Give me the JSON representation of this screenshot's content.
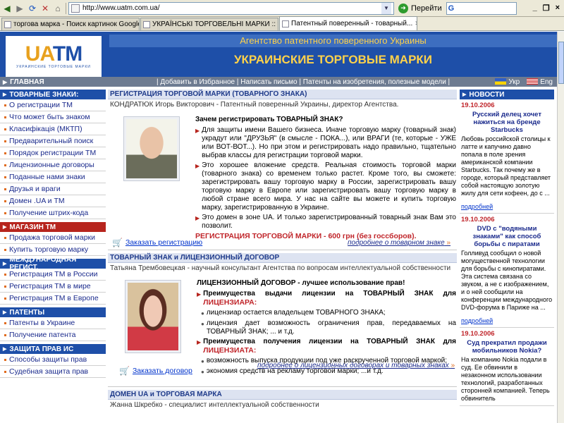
{
  "browser": {
    "url": "http://www.uatm.com.ua/",
    "go_label": "Перейти",
    "search_brand": "G",
    "window_controls": [
      "_",
      "❐",
      "×"
    ],
    "tabs": [
      {
        "label": "торгова марка - Поиск картинок Google",
        "active": false
      },
      {
        "label": "УКРАЇНСЬКІ ТОРГОВЕЛЬНІ МАРКИ :: торг...",
        "active": false
      },
      {
        "label": "Патентный поверенный - товарный...",
        "active": true
      }
    ]
  },
  "banner": {
    "logo_text_a": "UA",
    "logo_text_b": "TM",
    "logo_sub": "УКРАИНСКИЕ ТОРГОВЫЕ МАРКИ",
    "agency": "Агентство патентного поверенного Украины",
    "title": "УКРАИНСКИЕ ТОРГОВЫЕ МАРКИ"
  },
  "navbar": {
    "home": "ГЛАВНАЯ",
    "links": "| Добавить в Избранное | Написать письмо | Патенты на изобретения, полезные модели |",
    "lang_ua": "Укр",
    "lang_en": "Eng"
  },
  "left": [
    {
      "header": "ТОВАРНЫЕ ЗНАКИ:",
      "red": false,
      "items": [
        "О регистрации ТМ",
        "Что может быть знаком",
        "Класифікація (МКТП)",
        "Предварительный поиск",
        "Порядок регистрации ТМ",
        "Лицензионные договоры",
        "Поданные нами знаки",
        "Друзья и враги",
        "Домен .UA и ТМ",
        "Получение штрих-кода"
      ]
    },
    {
      "header": "МАГАЗИН ТМ",
      "red": true,
      "items": [
        "Продажа торговой марки",
        "Купить торговую марку"
      ]
    },
    {
      "header": "МЕЖДУНАРОДНАЯ РЕГИСТ.",
      "red": false,
      "items": [
        "Регистрация ТМ в России",
        "Регистрация ТМ в мире",
        "Регистрация ТМ в Европе"
      ]
    },
    {
      "header": "ПАТЕНТЫ",
      "red": false,
      "items": [
        "Патенты в Украине",
        "Получение патента"
      ]
    },
    {
      "header": "ЗАЩИТА ПРАВ ИС",
      "red": false,
      "items": [
        "Способы защиты прав",
        "Судебная защита прав"
      ]
    }
  ],
  "center": {
    "s1": {
      "header": "РЕГИСТРАЦИЯ ТОРГОВОЙ МАРКИ (ТОВАРНОГО ЗНАКА)",
      "byline": "КОНДРАТЮК Игорь Викторович - Патентный поверенный Украины, директор Агентства.",
      "question": "Зачем регистрировать ТОВАРНЫЙ ЗНАК?",
      "b1": "Для защиты имени Вашего бизнеса. Иначе торговую марку (товарный знак) украдут или \"ДРУЗЬЯ\" (в смысле - ПОКА...), или ВРАГИ (те, которые - УЖЕ или ВОТ-ВОТ...). Но при этом и регистрировать надо правильно, тщательно выбрав классы для регистрации торговой марки.",
      "b2": "Это хорошее вложение средств. Реальная стоимость торговой марки (товарного знака) со временем только растет. Кроме того, вы сможете: зарегистрировать вашу торговую марку в России, зарегистрировать вашу торговую марку в Европе или зарегистрировать вашу торговую марку в любой стране всего мира. У нас на сайте вы можете и купить торговую марку, зарегистрированную в Украине.",
      "b3": "Это домен в зоне UA. И только зарегистрированный товарный знак Вам это позволит.",
      "price": "РЕГИСТРАЦИЯ ТОРГОВОЙ МАРКИ - 600 грн (без госсборов).",
      "order": "Заказать регистрацию",
      "more": "подробнее о товарном знаке"
    },
    "s2": {
      "header": "ТОВАРНЫЙ ЗНАК и ЛИЦЕНЗИОННЫЙ ДОГОВОР",
      "byline": "Татьяна Трембовецкая - научный консультант Агентства по вопросам интеллектуальной собственности",
      "title": "ЛИЦЕНЗИОННЫЙ ДОГОВОР - лучшее использование прав!",
      "g1_pre": "Преимущества выдачи лицензии на ТОВАРНЫЙ ЗНАК для ",
      "g1_key": "ЛИЦЕНЗИАРА:",
      "g1_items": [
        "лицензиар остается владельцем ТОВАРНОГО ЗНАКА;",
        "лицензия дает возможность ограничения прав, передаваемых на ТОВАРНЫЙ ЗНАК; ... и т.д."
      ],
      "g2_pre": "Преимущества получения лицензии на ТОВАРНЫЙ ЗНАК для ",
      "g2_key": "ЛИЦЕНЗИАТА:",
      "g2_items": [
        "возможность выпуска продукции под уже раскрученной торговой маркой;",
        "экономия средств на рекламу торговой марки; ...и т.д."
      ],
      "order": "Заказать договор",
      "more": "подробнее о лицензионных договорах и товарных знаках"
    },
    "s3": {
      "header": "ДОМЕН UA и ТОРГОВАЯ МАРКА",
      "byline": "Жанна Шкребко - специалист интеллектуальной собственности"
    }
  },
  "news": {
    "header": "НОВОСТИ",
    "items": [
      {
        "date": "19.10.2006",
        "title": "Русский делец хочет нажиться на бренде Starbucks",
        "text": "Любовь российской столицы к латте и капучино давно попала в поле зрения американской компании Starbucks. Так почему же в городе, который представляет собой настоящую золотую жилу для сети кофеен, до с ...",
        "link": "подробней"
      },
      {
        "date": "19.10.2006",
        "title": "DVD с \"водяными знаками\" как способ борьбы с пиратами",
        "text": "Голливуд сообщил о новой могущественной технологии для борьбы с кинопиратами. Эта система связана со звуком, а не с изображением, и о ней сообщили на конференции международного DVD-форума в Париже на ...",
        "link": "подробней"
      },
      {
        "date": "19.10.2006",
        "title": "Суд прекратил продажи мобильников Nokia?",
        "text": "На компанию Nokia подали в суд. Ее обвинили в незаконном использовании технологий, разработанных сторонней компанией. Теперь обвинитель",
        "link": ""
      }
    ]
  },
  "colors": {
    "brand_blue": "#1e4fa8",
    "accent_yellow": "#ffd24a",
    "accent_red": "#b7251e"
  }
}
